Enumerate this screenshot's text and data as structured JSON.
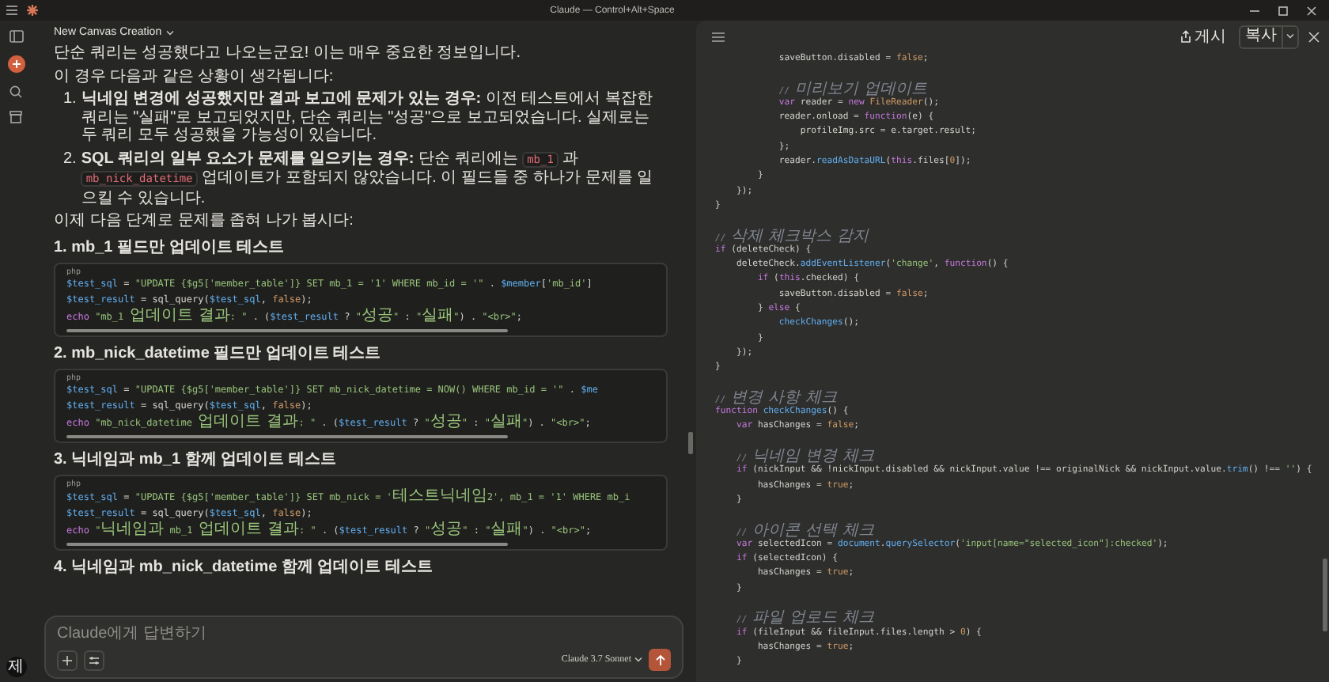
{
  "title_bar": {
    "title": "Claude — Control+Alt+Space"
  },
  "sidebar": {
    "avatar_initial": "제"
  },
  "chat": {
    "title": "New Canvas Creation",
    "blocks": [
      {
        "kind": "paragraph",
        "parts": [
          {
            "kind": "text",
            "text": "단순 쿼리는 성공했다고 나오는군요! 이는 매우 중요한 정보입니다."
          }
        ]
      },
      {
        "kind": "paragraph",
        "parts": [
          {
            "kind": "text",
            "text": "이 경우 다음과 같은 상황이 생각됩니다:"
          }
        ]
      },
      {
        "kind": "list_item",
        "number": "1.",
        "parts": [
          {
            "kind": "bold",
            "text": "닉네임 변경에 성공했지만 결과 보고에 문제가 있는 경우:"
          },
          {
            "kind": "text",
            "text": " 이전 테스트에서 복잡한 쿼리는 \"실패\"로 보고되었지만, 단순 쿼리는 \"성공\"으로 보고되었습니다. 실제로는 두 쿼리 모두 성공했을 가능성이 있습니다."
          }
        ]
      },
      {
        "kind": "list_item",
        "number": "2.",
        "parts": [
          {
            "kind": "bold",
            "text": "SQL 쿼리의 일부 요소가 문제를 일으키는 경우:"
          },
          {
            "kind": "text",
            "text": " 단순 쿼리에는 "
          },
          {
            "kind": "code",
            "text": "mb_1"
          },
          {
            "kind": "text",
            "text": " 과 "
          },
          {
            "kind": "code",
            "text": "mb_nick_datetime"
          },
          {
            "kind": "text",
            "text": " 업데이트가 포함되지 않았습니다. 이 필드들 중 하나가 문제를 일으킬 수 있습니다."
          }
        ]
      },
      {
        "kind": "paragraph",
        "parts": [
          {
            "kind": "text",
            "text": "이제 다음 단계로 문제를 좁혀 나가 봅시다:"
          }
        ]
      },
      {
        "kind": "heading",
        "text": "1. mb_1 필드만 업데이트 테스트"
      },
      {
        "kind": "code",
        "language": "php",
        "lines": [
          [
            {
              "kind": "variable",
              "text": "$test_sql"
            },
            {
              "kind": "plain",
              "text": " = "
            },
            {
              "kind": "string",
              "text": "\"UPDATE {$g5['member_table']} SET mb_1 = '1' WHERE mb_id = '\""
            },
            {
              "kind": "plain",
              "text": " . "
            },
            {
              "kind": "variable",
              "text": "$member"
            },
            {
              "kind": "plain",
              "text": "["
            },
            {
              "kind": "string",
              "text": "'mb_id'"
            },
            {
              "kind": "plain",
              "text": "]"
            }
          ],
          [
            {
              "kind": "variable",
              "text": "$test_result"
            },
            {
              "kind": "plain",
              "text": " = sql_query("
            },
            {
              "kind": "variable",
              "text": "$test_sql"
            },
            {
              "kind": "plain",
              "text": ", "
            },
            {
              "kind": "literal",
              "text": "false"
            },
            {
              "kind": "plain",
              "text": ");"
            }
          ],
          [
            {
              "kind": "keyword",
              "text": "echo "
            },
            {
              "kind": "string",
              "text": "\"mb_1 업데이트 결과: \""
            },
            {
              "kind": "plain",
              "text": " . ("
            },
            {
              "kind": "variable",
              "text": "$test_result"
            },
            {
              "kind": "plain",
              "text": " ? "
            },
            {
              "kind": "string",
              "text": "\"성공\""
            },
            {
              "kind": "plain",
              "text": " : "
            },
            {
              "kind": "string",
              "text": "\"실패\""
            },
            {
              "kind": "plain",
              "text": ") . "
            },
            {
              "kind": "string",
              "text": "\"<br>\""
            },
            {
              "kind": "plain",
              "text": ";"
            }
          ]
        ]
      },
      {
        "kind": "heading",
        "text": "2. mb_nick_datetime 필드만 업데이트 테스트"
      },
      {
        "kind": "code",
        "language": "php",
        "lines": [
          [
            {
              "kind": "variable",
              "text": "$test_sql"
            },
            {
              "kind": "plain",
              "text": " = "
            },
            {
              "kind": "string",
              "text": "\"UPDATE {$g5['member_table']} SET mb_nick_datetime = NOW() WHERE mb_id = '\""
            },
            {
              "kind": "plain",
              "text": " . "
            },
            {
              "kind": "variable",
              "text": "$me"
            }
          ],
          [
            {
              "kind": "variable",
              "text": "$test_result"
            },
            {
              "kind": "plain",
              "text": " = sql_query("
            },
            {
              "kind": "variable",
              "text": "$test_sql"
            },
            {
              "kind": "plain",
              "text": ", "
            },
            {
              "kind": "literal",
              "text": "false"
            },
            {
              "kind": "plain",
              "text": ");"
            }
          ],
          [
            {
              "kind": "keyword",
              "text": "echo "
            },
            {
              "kind": "string",
              "text": "\"mb_nick_datetime 업데이트 결과: \""
            },
            {
              "kind": "plain",
              "text": " . ("
            },
            {
              "kind": "variable",
              "text": "$test_result"
            },
            {
              "kind": "plain",
              "text": " ? "
            },
            {
              "kind": "string",
              "text": "\"성공\""
            },
            {
              "kind": "plain",
              "text": " : "
            },
            {
              "kind": "string",
              "text": "\"실패\""
            },
            {
              "kind": "plain",
              "text": ") . "
            },
            {
              "kind": "string",
              "text": "\"<br>\""
            },
            {
              "kind": "plain",
              "text": ";"
            }
          ]
        ]
      },
      {
        "kind": "heading",
        "text": "3. 닉네임과 mb_1 함께 업데이트 테스트"
      },
      {
        "kind": "code",
        "language": "php",
        "lines": [
          [
            {
              "kind": "variable",
              "text": "$test_sql"
            },
            {
              "kind": "plain",
              "text": " = "
            },
            {
              "kind": "string",
              "text": "\"UPDATE {$g5['member_table']} SET mb_nick = '테스트닉네임2', mb_1 = '1' WHERE mb_i"
            }
          ],
          [
            {
              "kind": "variable",
              "text": "$test_result"
            },
            {
              "kind": "plain",
              "text": " = sql_query("
            },
            {
              "kind": "variable",
              "text": "$test_sql"
            },
            {
              "kind": "plain",
              "text": ", "
            },
            {
              "kind": "literal",
              "text": "false"
            },
            {
              "kind": "plain",
              "text": ");"
            }
          ],
          [
            {
              "kind": "keyword",
              "text": "echo "
            },
            {
              "kind": "string",
              "text": "\"닉네임과 mb_1 업데이트 결과: \""
            },
            {
              "kind": "plain",
              "text": " . ("
            },
            {
              "kind": "variable",
              "text": "$test_result"
            },
            {
              "kind": "plain",
              "text": " ? "
            },
            {
              "kind": "string",
              "text": "\"성공\""
            },
            {
              "kind": "plain",
              "text": " : "
            },
            {
              "kind": "string",
              "text": "\"실패\""
            },
            {
              "kind": "plain",
              "text": ") . "
            },
            {
              "kind": "string",
              "text": "\"<br>\""
            },
            {
              "kind": "plain",
              "text": ";"
            }
          ]
        ]
      },
      {
        "kind": "heading",
        "text": "4. 닉네임과 mb_nick_datetime 함께 업데이트 테스트"
      }
    ]
  },
  "composer": {
    "placeholder": "Claude에게 답변하기",
    "model": "Claude 3.7 Sonnet"
  },
  "canvas": {
    "publish_label": "게시",
    "copy_label": "복사",
    "lines": [
      {
        "kind": "code",
        "tokens": [
          {
            "kind": "plain",
            "text": "            saveButton.disabled = "
          },
          {
            "kind": "literal",
            "text": "false"
          },
          {
            "kind": "plain",
            "text": ";"
          }
        ]
      },
      {
        "kind": "blank"
      },
      {
        "kind": "code",
        "tokens": [
          {
            "kind": "comment",
            "text": "            // 미리보기 업데이트"
          }
        ]
      },
      {
        "kind": "code",
        "tokens": [
          {
            "kind": "keyword",
            "text": "            var"
          },
          {
            "kind": "plain",
            "text": " reader = "
          },
          {
            "kind": "keyword",
            "text": "new "
          },
          {
            "kind": "literal",
            "text": "FileReader"
          },
          {
            "kind": "plain",
            "text": "();"
          }
        ]
      },
      {
        "kind": "code",
        "tokens": [
          {
            "kind": "plain",
            "text": "            reader.onload = "
          },
          {
            "kind": "keyword",
            "text": "function"
          },
          {
            "kind": "plain",
            "text": "(e) {"
          }
        ]
      },
      {
        "kind": "code",
        "tokens": [
          {
            "kind": "plain",
            "text": "                profileImg.src = e.target.result;"
          }
        ]
      },
      {
        "kind": "code",
        "tokens": [
          {
            "kind": "plain",
            "text": "            };"
          }
        ]
      },
      {
        "kind": "code",
        "tokens": [
          {
            "kind": "plain",
            "text": "            reader."
          },
          {
            "kind": "function",
            "text": "readAsDataURL"
          },
          {
            "kind": "plain",
            "text": "("
          },
          {
            "kind": "keyword",
            "text": "this"
          },
          {
            "kind": "plain",
            "text": ".files["
          },
          {
            "kind": "literal",
            "text": "0"
          },
          {
            "kind": "plain",
            "text": "]);"
          }
        ]
      },
      {
        "kind": "code",
        "tokens": [
          {
            "kind": "plain",
            "text": "        }"
          }
        ]
      },
      {
        "kind": "code",
        "tokens": [
          {
            "kind": "plain",
            "text": "    });"
          }
        ]
      },
      {
        "kind": "code",
        "tokens": [
          {
            "kind": "plain",
            "text": "}"
          }
        ]
      },
      {
        "kind": "blank"
      },
      {
        "kind": "code",
        "tokens": [
          {
            "kind": "comment",
            "text": "// 삭제 체크박스 감지"
          }
        ]
      },
      {
        "kind": "code",
        "tokens": [
          {
            "kind": "keyword",
            "text": "if"
          },
          {
            "kind": "plain",
            "text": " (deleteCheck) {"
          }
        ]
      },
      {
        "kind": "code",
        "tokens": [
          {
            "kind": "plain",
            "text": "    deleteCheck."
          },
          {
            "kind": "function",
            "text": "addEventListener"
          },
          {
            "kind": "plain",
            "text": "("
          },
          {
            "kind": "string",
            "text": "'change'"
          },
          {
            "kind": "plain",
            "text": ", "
          },
          {
            "kind": "keyword",
            "text": "function"
          },
          {
            "kind": "plain",
            "text": "() {"
          }
        ]
      },
      {
        "kind": "code",
        "tokens": [
          {
            "kind": "keyword",
            "text": "        if"
          },
          {
            "kind": "plain",
            "text": " ("
          },
          {
            "kind": "keyword",
            "text": "this"
          },
          {
            "kind": "plain",
            "text": ".checked) {"
          }
        ]
      },
      {
        "kind": "code",
        "tokens": [
          {
            "kind": "plain",
            "text": "            saveButton.disabled = "
          },
          {
            "kind": "literal",
            "text": "false"
          },
          {
            "kind": "plain",
            "text": ";"
          }
        ]
      },
      {
        "kind": "code",
        "tokens": [
          {
            "kind": "plain",
            "text": "        } "
          },
          {
            "kind": "keyword",
            "text": "else"
          },
          {
            "kind": "plain",
            "text": " {"
          }
        ]
      },
      {
        "kind": "code",
        "tokens": [
          {
            "kind": "function",
            "text": "            checkChanges"
          },
          {
            "kind": "plain",
            "text": "();"
          }
        ]
      },
      {
        "kind": "code",
        "tokens": [
          {
            "kind": "plain",
            "text": "        }"
          }
        ]
      },
      {
        "kind": "code",
        "tokens": [
          {
            "kind": "plain",
            "text": "    });"
          }
        ]
      },
      {
        "kind": "code",
        "tokens": [
          {
            "kind": "plain",
            "text": "}"
          }
        ]
      },
      {
        "kind": "blank"
      },
      {
        "kind": "code",
        "tokens": [
          {
            "kind": "comment",
            "text": "// 변경 사항 체크"
          }
        ]
      },
      {
        "kind": "code",
        "tokens": [
          {
            "kind": "keyword",
            "text": "function "
          },
          {
            "kind": "function",
            "text": "checkChanges"
          },
          {
            "kind": "plain",
            "text": "() {"
          }
        ]
      },
      {
        "kind": "code",
        "tokens": [
          {
            "kind": "keyword",
            "text": "    var"
          },
          {
            "kind": "plain",
            "text": " hasChanges = "
          },
          {
            "kind": "literal",
            "text": "false"
          },
          {
            "kind": "plain",
            "text": ";"
          }
        ]
      },
      {
        "kind": "blank"
      },
      {
        "kind": "code",
        "tokens": [
          {
            "kind": "comment",
            "text": "    // 닉네임 변경 체크"
          }
        ]
      },
      {
        "kind": "code",
        "tokens": [
          {
            "kind": "keyword",
            "text": "    if"
          },
          {
            "kind": "plain",
            "text": " (nickInput && !nickInput.disabled && nickInput.value !== originalNick && nickInput.value."
          },
          {
            "kind": "function",
            "text": "trim"
          },
          {
            "kind": "plain",
            "text": "() !== "
          },
          {
            "kind": "string",
            "text": "''"
          },
          {
            "kind": "plain",
            "text": ") {"
          }
        ]
      },
      {
        "kind": "code",
        "tokens": [
          {
            "kind": "plain",
            "text": "        hasChanges = "
          },
          {
            "kind": "literal",
            "text": "true"
          },
          {
            "kind": "plain",
            "text": ";"
          }
        ]
      },
      {
        "kind": "code",
        "tokens": [
          {
            "kind": "plain",
            "text": "    }"
          }
        ]
      },
      {
        "kind": "blank"
      },
      {
        "kind": "code",
        "tokens": [
          {
            "kind": "comment",
            "text": "    // 아이콘 선택 체크"
          }
        ]
      },
      {
        "kind": "code",
        "tokens": [
          {
            "kind": "keyword",
            "text": "    var"
          },
          {
            "kind": "plain",
            "text": " selectedIcon = "
          },
          {
            "kind": "function",
            "text": "document"
          },
          {
            "kind": "plain",
            "text": "."
          },
          {
            "kind": "function",
            "text": "querySelector"
          },
          {
            "kind": "plain",
            "text": "("
          },
          {
            "kind": "string",
            "text": "'input[name=\"selected_icon\"]:checked'"
          },
          {
            "kind": "plain",
            "text": ");"
          }
        ]
      },
      {
        "kind": "code",
        "tokens": [
          {
            "kind": "keyword",
            "text": "    if"
          },
          {
            "kind": "plain",
            "text": " (selectedIcon) {"
          }
        ]
      },
      {
        "kind": "code",
        "tokens": [
          {
            "kind": "plain",
            "text": "        hasChanges = "
          },
          {
            "kind": "literal",
            "text": "true"
          },
          {
            "kind": "plain",
            "text": ";"
          }
        ]
      },
      {
        "kind": "code",
        "tokens": [
          {
            "kind": "plain",
            "text": "    }"
          }
        ]
      },
      {
        "kind": "blank"
      },
      {
        "kind": "code",
        "tokens": [
          {
            "kind": "comment",
            "text": "    // 파일 업로드 체크"
          }
        ]
      },
      {
        "kind": "code",
        "tokens": [
          {
            "kind": "keyword",
            "text": "    if"
          },
          {
            "kind": "plain",
            "text": " (fileInput && fileInput.files.length > "
          },
          {
            "kind": "literal",
            "text": "0"
          },
          {
            "kind": "plain",
            "text": ") {"
          }
        ]
      },
      {
        "kind": "code",
        "tokens": [
          {
            "kind": "plain",
            "text": "        hasChanges = "
          },
          {
            "kind": "literal",
            "text": "true"
          },
          {
            "kind": "plain",
            "text": ";"
          }
        ]
      },
      {
        "kind": "code",
        "tokens": [
          {
            "kind": "plain",
            "text": "    }"
          }
        ]
      }
    ]
  }
}
